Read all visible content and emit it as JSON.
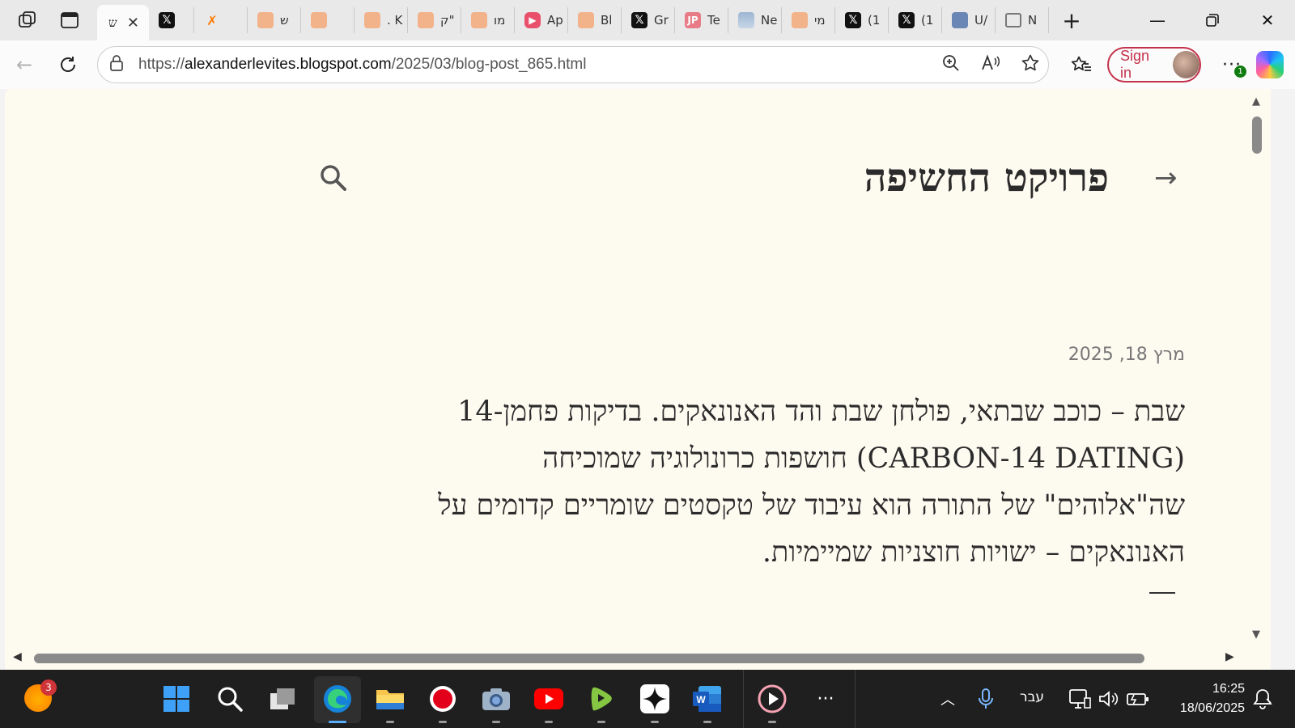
{
  "browser": {
    "active_tab": {
      "title": "ש"
    },
    "tabs": [
      {
        "icon": "x-logo-icon",
        "title": "",
        "fav_class": "x",
        "glyph": "𝕏"
      },
      {
        "icon": "fire-icon",
        "title": "",
        "fav_class": "fire",
        "glyph": "✗"
      },
      {
        "icon": "blogger-icon",
        "title": "ש",
        "fav_class": "blogger",
        "glyph": ""
      },
      {
        "icon": "document-icon",
        "title": "",
        "fav_class": "blogger",
        "glyph": ""
      },
      {
        "icon": "blogger-icon",
        "title": ". K",
        "fav_class": "blogger",
        "glyph": ""
      },
      {
        "icon": "blogger-icon",
        "title": "ק\"",
        "fav_class": "blogger",
        "glyph": ""
      },
      {
        "icon": "blogger-icon",
        "title": "מו",
        "fav_class": "blogger",
        "glyph": ""
      },
      {
        "icon": "youtube-icon",
        "title": "Ap",
        "fav_class": "yt",
        "glyph": "▶"
      },
      {
        "icon": "blogger-icon",
        "title": "Bl",
        "fav_class": "blogger",
        "glyph": ""
      },
      {
        "icon": "x-logo-icon",
        "title": "Gr",
        "fav_class": "x",
        "glyph": "𝕏"
      },
      {
        "icon": "jp-icon",
        "title": "Te",
        "fav_class": "jp",
        "glyph": "JP"
      },
      {
        "icon": "image-icon",
        "title": "Ne",
        "fav_class": "img",
        "glyph": ""
      },
      {
        "icon": "blogger-icon",
        "title": "מי",
        "fav_class": "blogger",
        "glyph": ""
      },
      {
        "icon": "x-logo-icon",
        "title": "(1",
        "fav_class": "x",
        "glyph": "𝕏"
      },
      {
        "icon": "x-logo-icon",
        "title": "(1",
        "fav_class": "x",
        "glyph": "𝕏"
      },
      {
        "icon": "news-icon",
        "title": "U/",
        "fav_class": "ui",
        "glyph": ""
      },
      {
        "icon": "page-icon",
        "title": "N",
        "fav_class": "box",
        "glyph": ""
      }
    ],
    "url": {
      "scheme": "https://",
      "host": "alexanderlevites.blogspot.com",
      "path": "/2025/03/blog-post_865.html"
    },
    "sign_in_label": "Sign in",
    "extensions_badge": "1"
  },
  "page": {
    "title": "פרויקט החשיפה",
    "date": "מרץ 18, 2025",
    "paragraph_lines": [
      "שבת – כוכב שבתאי, פולחן שבת והד האנונאקים. בדיקות פחמן-14",
      "(CARBON-14 DATING) חושפות כרונולוגיה שמוכיחה",
      "שה\"אלוהים\" של התורה הוא עיבוד של טקסטים שומריים קדומים על",
      "האנונאקים – ישויות חוצניות שמיימיות."
    ]
  },
  "taskbar": {
    "weather_badge": "3",
    "language": "עבר",
    "time": "16:25",
    "date": "18/06/2025"
  }
}
